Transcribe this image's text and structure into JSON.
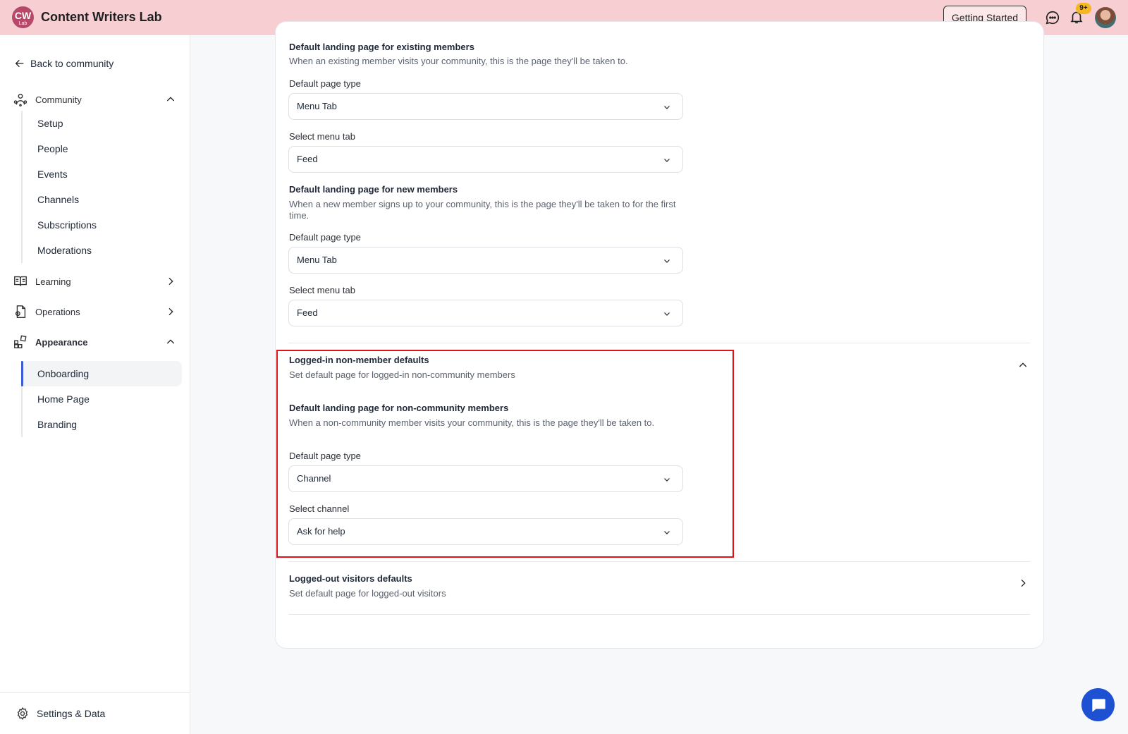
{
  "app": {
    "logo_initials": "CW",
    "logo_sub": "Lab",
    "title": "Content Writers Lab"
  },
  "header": {
    "getting_started": "Getting Started",
    "notification_count": "9+"
  },
  "sidebar": {
    "back": "Back to community",
    "community": {
      "label": "Community",
      "items": [
        "Setup",
        "People",
        "Events",
        "Channels",
        "Subscriptions",
        "Moderations"
      ]
    },
    "learning": {
      "label": "Learning"
    },
    "operations": {
      "label": "Operations"
    },
    "appearance": {
      "label": "Appearance",
      "items": [
        "Onboarding",
        "Home Page",
        "Branding"
      ],
      "active": "Onboarding"
    },
    "settings": "Settings & Data"
  },
  "main": {
    "existing": {
      "title": "Default landing page for existing members",
      "desc": "When an existing member visits your community, this is the page they'll be taken to.",
      "page_type_label": "Default page type",
      "page_type_value": "Menu Tab",
      "tab_label": "Select menu tab",
      "tab_value": "Feed"
    },
    "new_members": {
      "title": "Default landing page for new members",
      "desc": "When a new member signs up to your community, this is the page they'll be taken to for the first time.",
      "page_type_label": "Default page type",
      "page_type_value": "Menu Tab",
      "tab_label": "Select menu tab",
      "tab_value": "Feed"
    },
    "non_member": {
      "section_title": "Logged-in non-member defaults",
      "section_desc": "Set default page for logged-in non-community members",
      "title": "Default landing page for non-community members",
      "desc": "When a non-community member visits your community, this is the page they'll be taken to.",
      "page_type_label": "Default page type",
      "page_type_value": "Channel",
      "channel_label": "Select channel",
      "channel_value": "Ask for help"
    },
    "logged_out": {
      "section_title": "Logged-out visitors defaults",
      "section_desc": "Set default page for logged-out visitors"
    }
  },
  "colors": {
    "header_bg": "#f7cfd2",
    "accent": "#3b5bdb",
    "highlight": "#e0131a",
    "fab": "#1e50d2"
  }
}
